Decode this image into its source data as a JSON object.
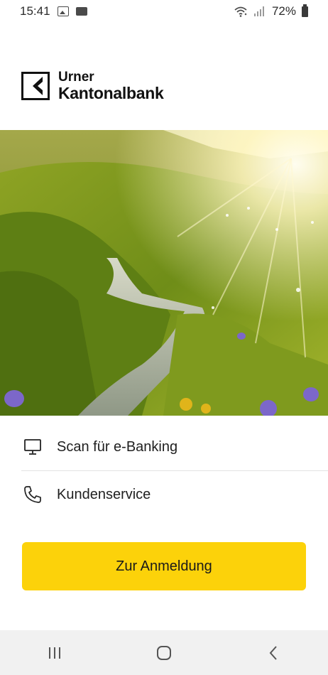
{
  "status_bar": {
    "time": "15:41",
    "notification_icons": [
      "image-icon",
      "sonos-icon"
    ],
    "sonos_text": "SONOS",
    "battery": "72%",
    "right_icons": [
      "wifi-icon",
      "signal-icon",
      "battery-icon"
    ]
  },
  "logo": {
    "line1": "Urner",
    "line2": "Kantonalbank"
  },
  "hero": {
    "alt_icon": "mountain-meadow-photo"
  },
  "menu": {
    "items": [
      {
        "label": "Scan für e-Banking",
        "icon": "monitor-icon"
      },
      {
        "label": "Kundenservice",
        "icon": "phone-icon"
      }
    ]
  },
  "primary_button": {
    "label": "Zur Anmeldung",
    "color": "#fcd20a"
  },
  "nav_bar": {
    "buttons": [
      "recent-apps-icon",
      "home-icon",
      "back-icon"
    ]
  }
}
